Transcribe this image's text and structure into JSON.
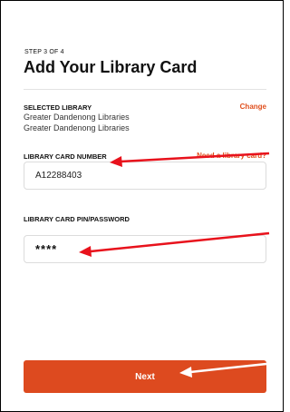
{
  "header": {
    "step": "STEP 3 OF 4",
    "title": "Add Your Library Card"
  },
  "selected_library": {
    "label": "SELECTED LIBRARY",
    "change_link": "Change",
    "lines": [
      "Greater Dandenong Libraries",
      "Greater Dandenong Libraries"
    ]
  },
  "card_number": {
    "label": "LIBRARY CARD NUMBER",
    "help_link": "Need a library card?",
    "value": "A12288403"
  },
  "pin": {
    "label": "LIBRARY CARD PIN/PASSWORD",
    "value": "****"
  },
  "actions": {
    "next_label": "Next"
  },
  "colors": {
    "accent": "#dd4a1f",
    "link": "#e0501e",
    "annotation_arrow": "#e8121c"
  }
}
